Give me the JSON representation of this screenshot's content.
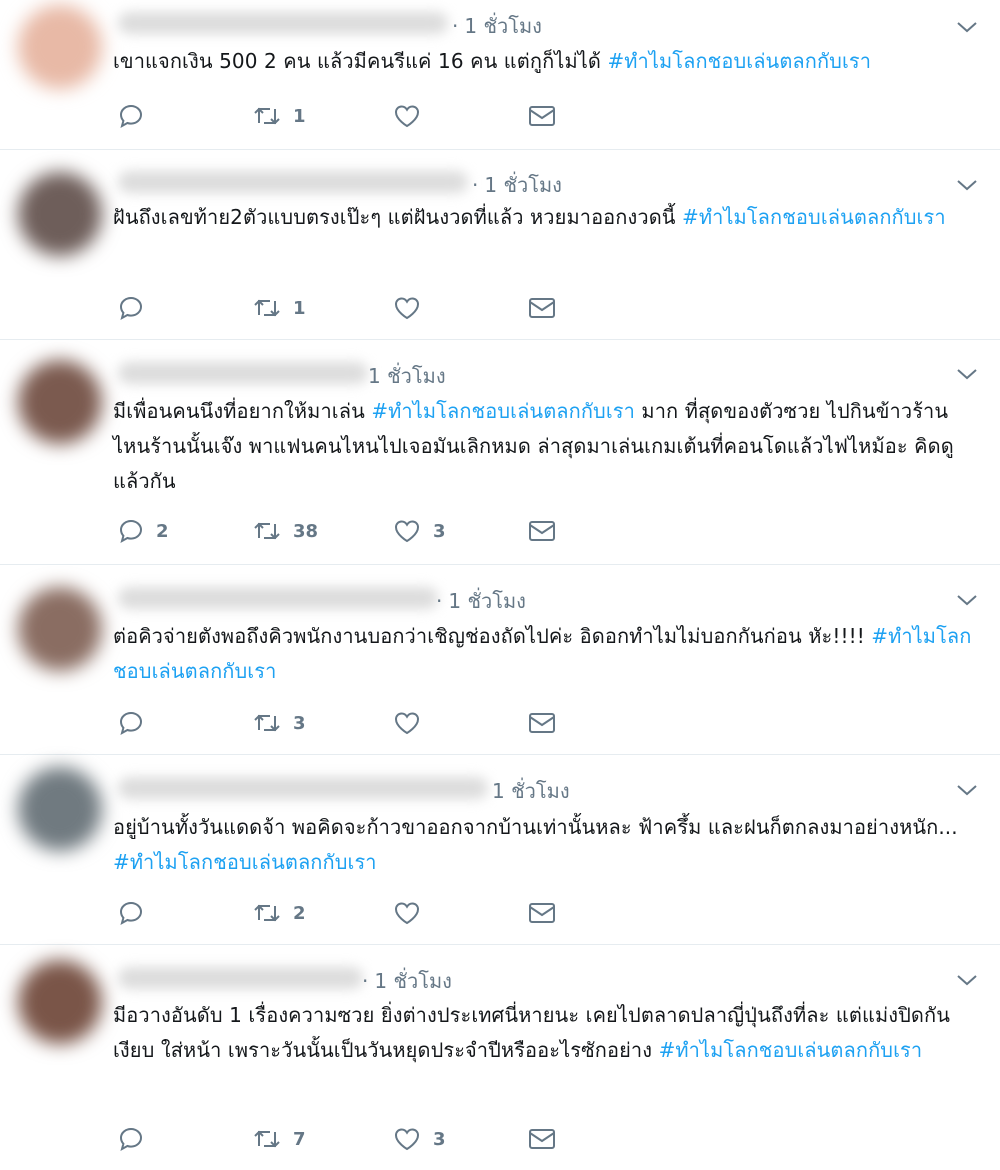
{
  "tweets": [
    {
      "time": "1 ชั่วโมง",
      "text": "เขาแจกเงิน 500 2 คน แล้วมีคนรีแค่ 16 คน แต่กูก็ไม่ได้ ",
      "hashtag": "#ทำไมโลกชอบเล่นตลกกับเรา",
      "reply_count": "",
      "retweet_count": "1",
      "like_count": ""
    },
    {
      "time": "1 ชั่วโมง",
      "text": "ฝันถึงเลขท้าย2ตัวแบบตรงเป๊ะๆ แต่ฝันงวดที่แล้ว หวยมาออกงวดนี้ ",
      "hashtag": "#ทำไมโลกชอบเล่นตลกกับเรา",
      "reply_count": "",
      "retweet_count": "1",
      "like_count": ""
    },
    {
      "time": "1 ชั่วโมง",
      "text_before": "มีเพื่อนคนนึงที่อยากให้มาเล่น ",
      "hashtag": "#ทำไมโลกชอบเล่นตลกกับเรา",
      "text_after": " มาก ที่สุดของตัวซวย ไปกินข้าวร้านไหนร้านนั้นเจ๊ง พาแฟนคนไหนไปเจอมันเลิกหมด ล่าสุดมาเล่นเกมเต้นที่คอนโดแล้วไฟไหม้อะ คิดดูแล้วกัน",
      "reply_count": "2",
      "retweet_count": "38",
      "like_count": "3"
    },
    {
      "time": "1 ชั่วโมง",
      "text": "ต่อคิวจ่ายตังพอถึงคิวพนักงานบอกว่าเชิญช่องถัดไปค่ะ อิดอกทำไมไม่บอกกันก่อน หัะ!!!! ",
      "hashtag": "#ทำไมโลกชอบเล่นตลกกับเรา",
      "reply_count": "",
      "retweet_count": "3",
      "like_count": ""
    },
    {
      "time": "1 ชั่วโมง",
      "text": "อยู่บ้านทั้งวันแดดจ้า พอคิดจะก้าวขาออกจากบ้านเท่านั้นหละ ฟ้าครึ้ม และฝนก็ตกลงมาอย่างหนัก... ",
      "hashtag": "#ทำไมโลกชอบเล่นตลกกับเรา",
      "reply_count": "",
      "retweet_count": "2",
      "like_count": ""
    },
    {
      "time": "1 ชั่วโมง",
      "text": "มีอวางอันดับ 1 เรื่องความซวย ยิ่งต่างประเทศนี่หายนะ เคยไปตลาดปลาญี่ปุ่นถึงที่ละ แต่แม่งปิดกันเงียบ ใส่หน้า เพราะวันนั้นเป็นวันหยุดประจำปีหรืออะไรซักอย่าง ",
      "hashtag": "#ทำไมโลกชอบเล่นตลกกับเรา",
      "reply_count": "",
      "retweet_count": "7",
      "like_count": "3"
    }
  ],
  "icons": [
    "reply-icon",
    "retweet-icon",
    "like-icon",
    "dm-icon",
    "chevron-down-icon"
  ],
  "colors": {
    "hashtag": "#1da1f2",
    "meta": "#657786",
    "divider": "#e6ecf0"
  }
}
